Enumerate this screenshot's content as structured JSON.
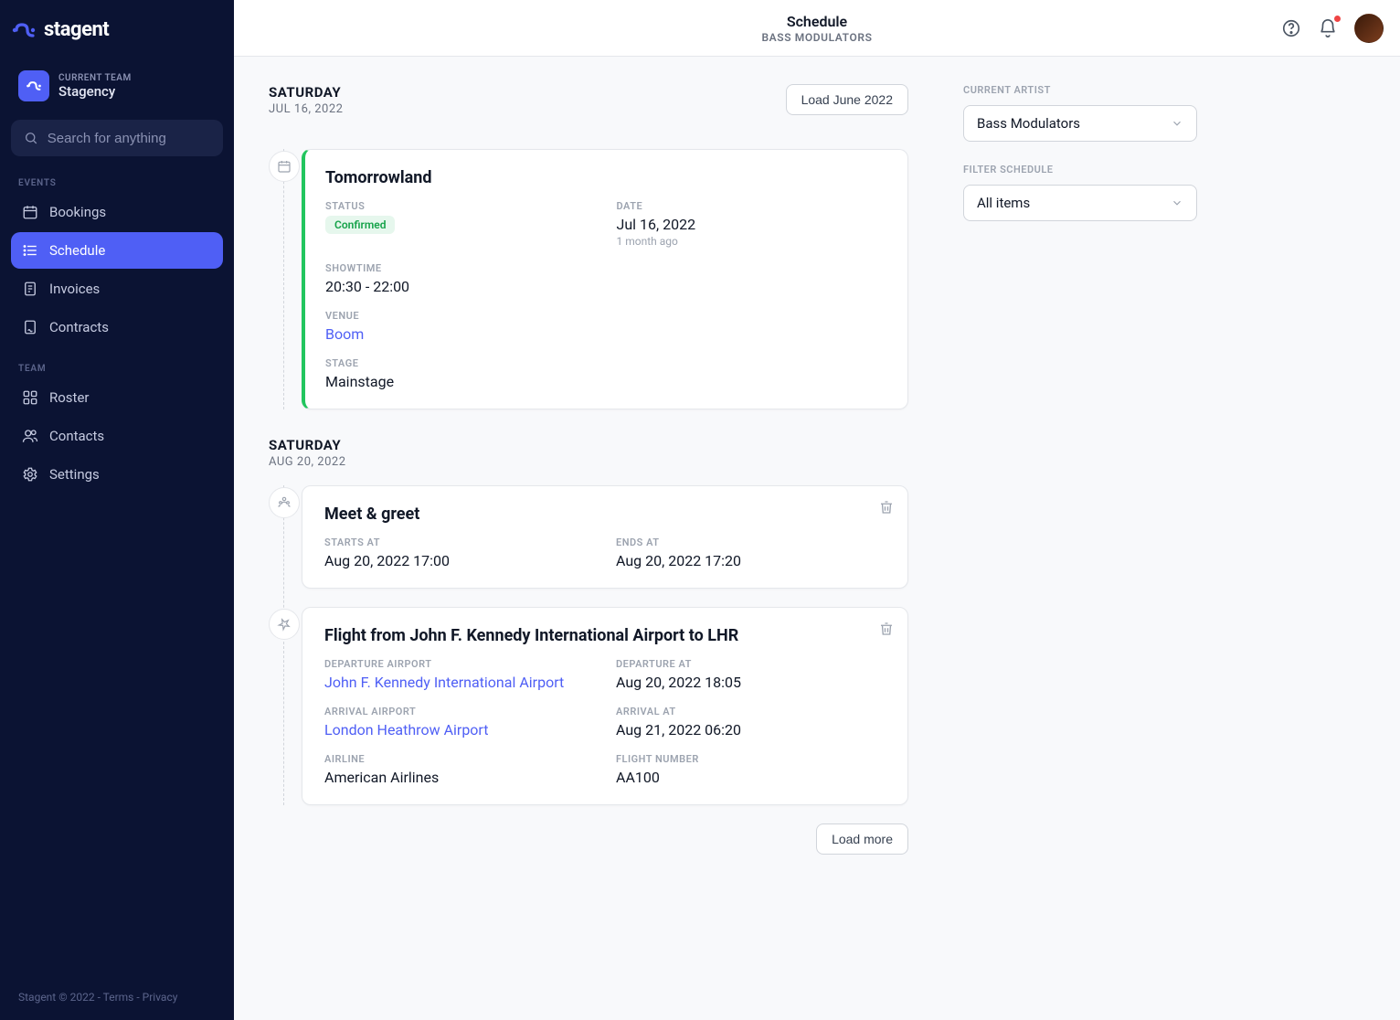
{
  "brand": {
    "name": "stagent"
  },
  "team": {
    "label": "CURRENT TEAM",
    "name": "Stagency"
  },
  "search": {
    "placeholder": "Search for anything"
  },
  "nav": {
    "events_label": "EVENTS",
    "team_label": "TEAM",
    "bookings": "Bookings",
    "schedule": "Schedule",
    "invoices": "Invoices",
    "contracts": "Contracts",
    "roster": "Roster",
    "contacts": "Contacts",
    "settings": "Settings"
  },
  "footer": {
    "copyright": "Stagent © 2022",
    "sep": " - ",
    "terms": "Terms",
    "privacy": "Privacy"
  },
  "header": {
    "title": "Schedule",
    "subtitle": "BASS MODULATORS"
  },
  "filters": {
    "current_artist_label": "CURRENT ARTIST",
    "current_artist_value": "Bass Modulators",
    "filter_schedule_label": "FILTER SCHEDULE",
    "filter_schedule_value": "All items"
  },
  "buttons": {
    "load_june": "Load June 2022",
    "load_more": "Load more"
  },
  "days": [
    {
      "name": "SATURDAY",
      "date": "JUL 16, 2022"
    },
    {
      "name": "SATURDAY",
      "date": "AUG 20, 2022"
    }
  ],
  "labels": {
    "status": "STATUS",
    "date": "DATE",
    "showtime": "SHOWTIME",
    "venue": "VENUE",
    "stage": "STAGE",
    "starts_at": "STARTS AT",
    "ends_at": "ENDS AT",
    "departure_airport": "DEPARTURE AIRPORT",
    "departure_at": "DEPARTURE AT",
    "arrival_airport": "ARRIVAL AIRPORT",
    "arrival_at": "ARRIVAL AT",
    "airline": "AIRLINE",
    "flight_number": "FLIGHT NUMBER"
  },
  "events": {
    "tomorrowland": {
      "title": "Tomorrowland",
      "status": "Confirmed",
      "date": "Jul 16, 2022",
      "date_rel": "1 month ago",
      "showtime": "20:30 - 22:00",
      "venue": "Boom",
      "stage": "Mainstage"
    },
    "meet_greet": {
      "title": "Meet & greet",
      "starts_at": "Aug 20, 2022 17:00",
      "ends_at": "Aug 20, 2022 17:20"
    },
    "flight": {
      "title": "Flight from John F. Kennedy International Airport to LHR",
      "departure_airport": "John F. Kennedy International Airport",
      "departure_at": "Aug 20, 2022 18:05",
      "arrival_airport": "London Heathrow Airport",
      "arrival_at": "Aug 21, 2022 06:20",
      "airline": "American Airlines",
      "flight_number": "AA100"
    }
  }
}
